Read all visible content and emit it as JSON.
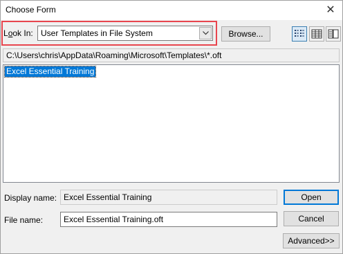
{
  "window": {
    "title": "Choose Form",
    "close_glyph": "✕"
  },
  "toolbar": {
    "look_in_label_prefix": "L",
    "look_in_label_underlined": "o",
    "look_in_label_suffix": "ok In:",
    "look_in_value": "User Templates in File System",
    "browse_label": "Browse...",
    "highlight_color": "#e8454e"
  },
  "path": "C:\\Users\\chris\\AppData\\Roaming\\Microsoft\\Templates\\*.oft",
  "list": {
    "items": [
      "Excel Essential Training"
    ]
  },
  "form": {
    "display_name_label": "Display name:",
    "display_name_value": "Excel Essential Training",
    "file_name_label": "File name:",
    "file_name_value": "Excel Essential Training.oft"
  },
  "buttons": {
    "open": "Open",
    "cancel": "Cancel",
    "advanced": "Advanced>>"
  },
  "colors": {
    "selection": "#0078d7",
    "default_button_border": "#0078d7"
  }
}
